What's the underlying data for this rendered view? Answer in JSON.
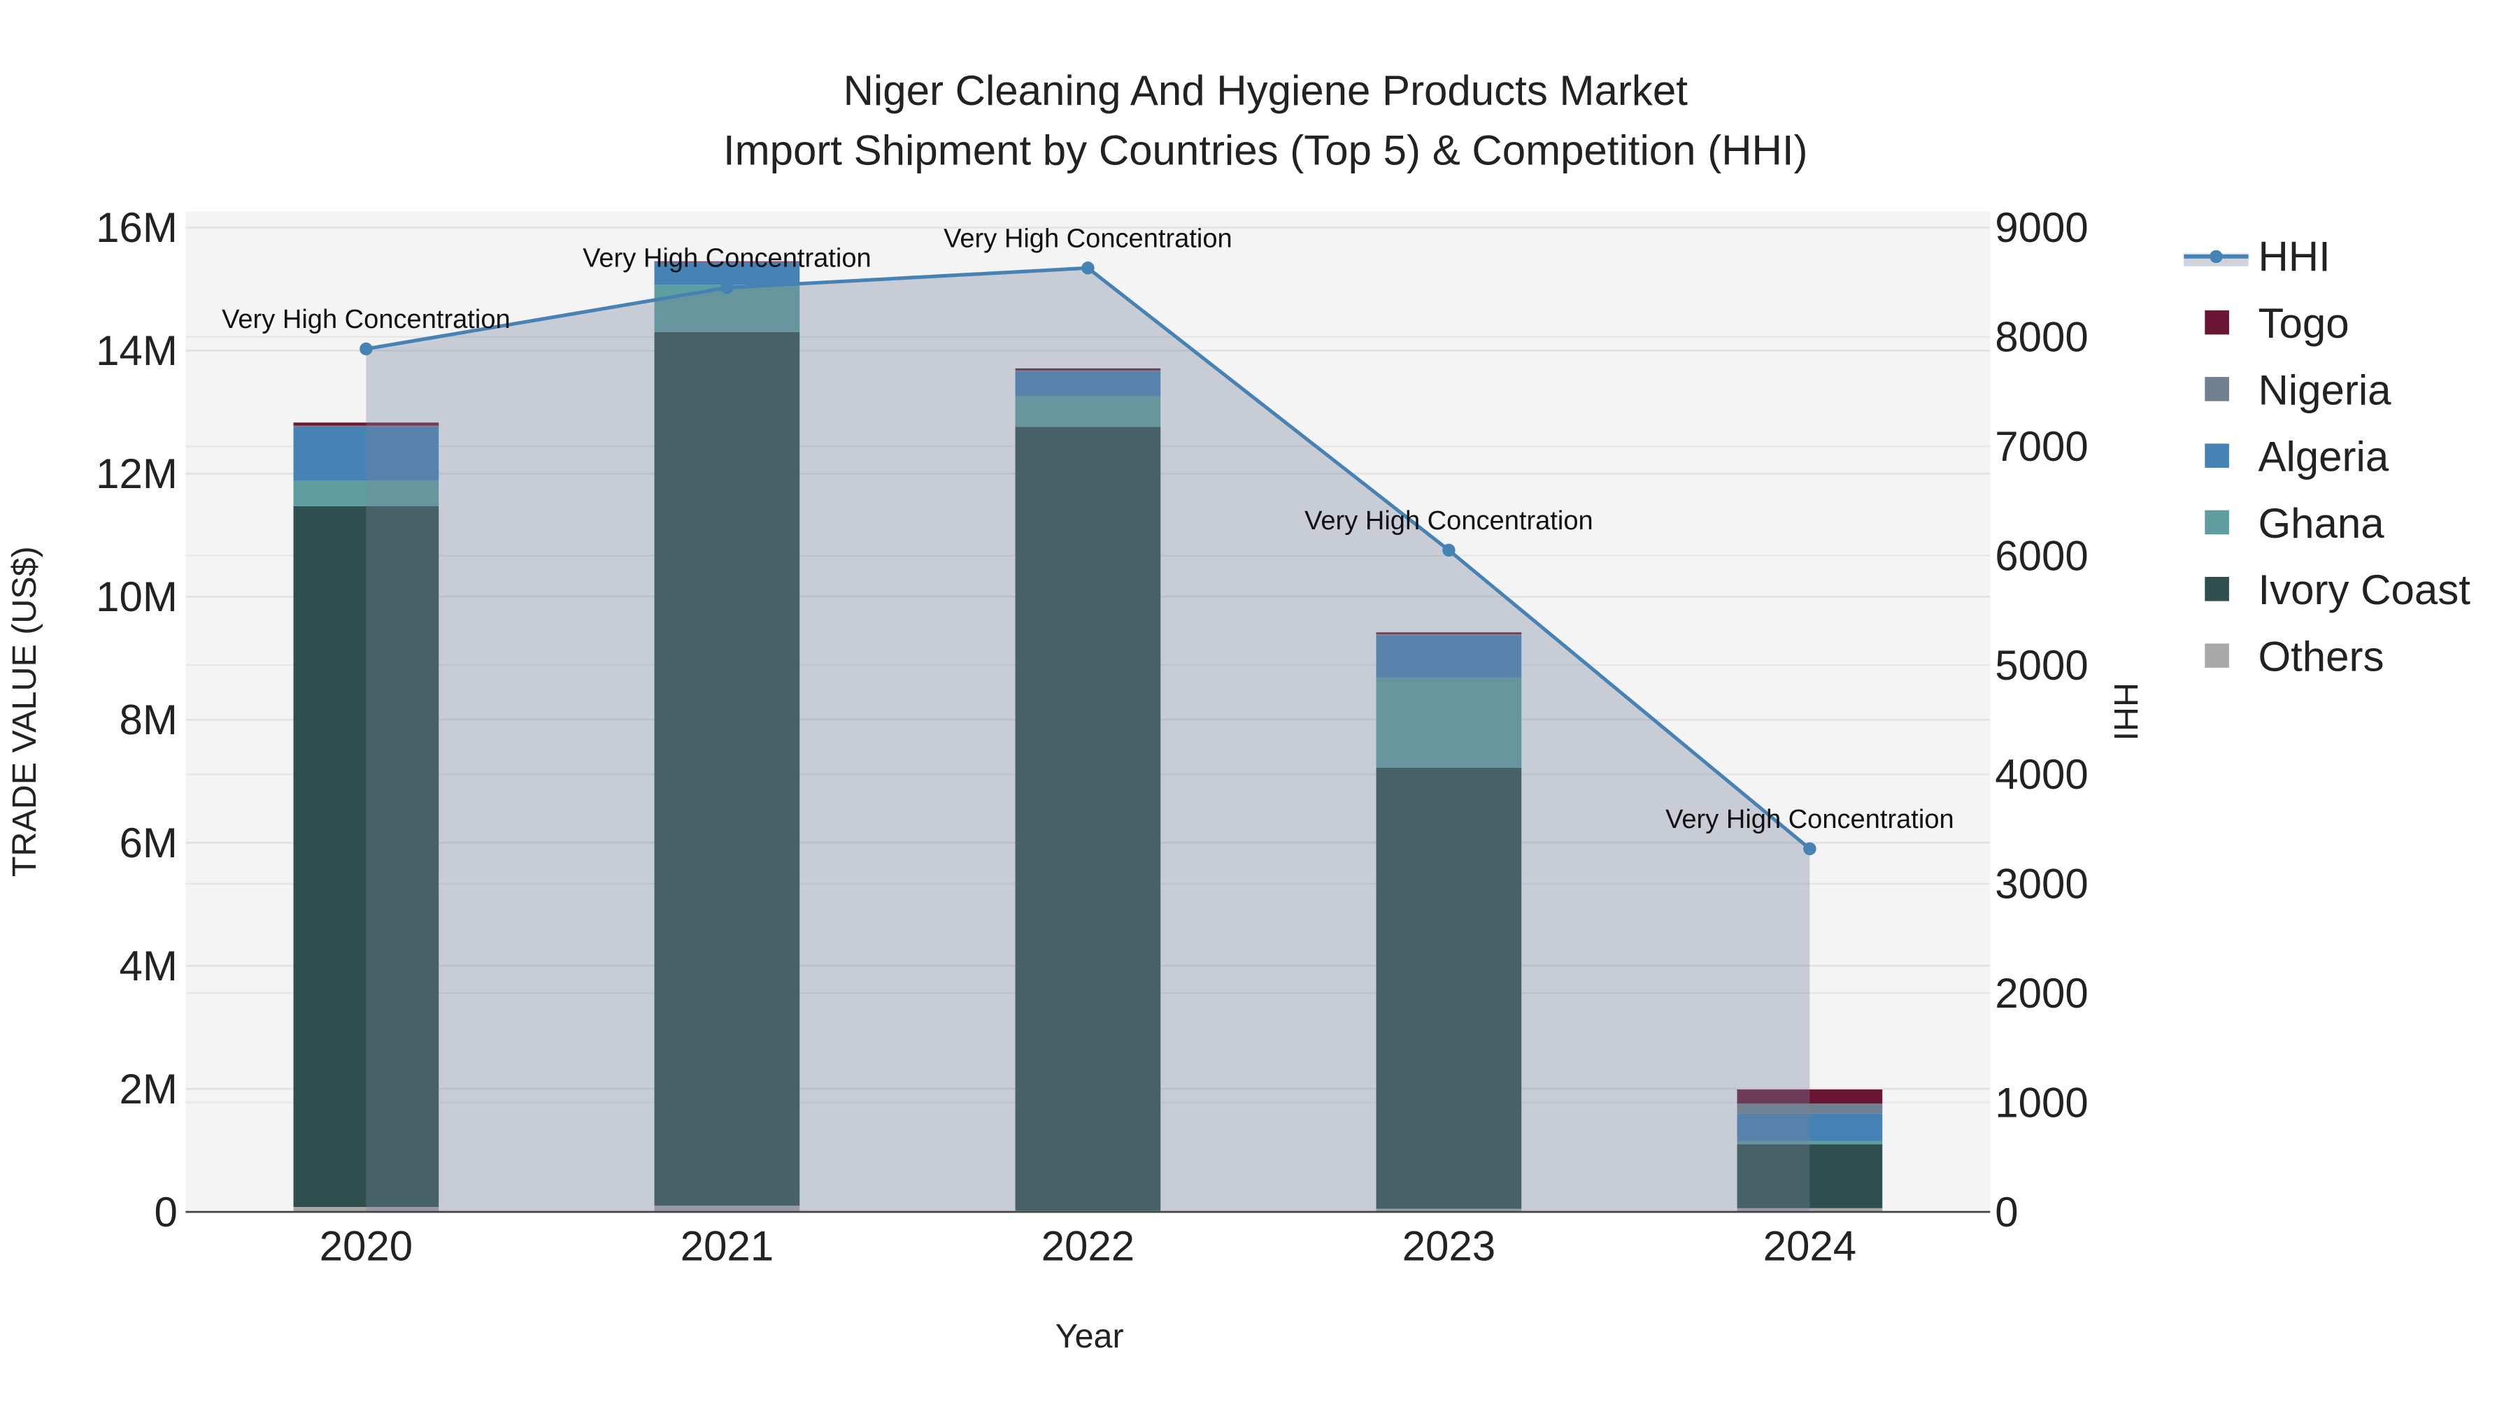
{
  "chart_data": {
    "type": "bar",
    "title": "Niger Cleaning And Hygiene Products Market",
    "subtitle": "Import Shipment by Countries (Top 5) & Competition (HHI)",
    "xlabel": "Year",
    "ylabel": "TRADE VALUE (US$)",
    "y2label": "HHI",
    "categories": [
      "2020",
      "2021",
      "2022",
      "2023",
      "2024"
    ],
    "ylim": [
      0,
      16000000
    ],
    "y2lim": [
      0,
      9000
    ],
    "yticks": [
      {
        "v": 0,
        "label": "0"
      },
      {
        "v": 2000000,
        "label": "2M"
      },
      {
        "v": 4000000,
        "label": "4M"
      },
      {
        "v": 6000000,
        "label": "6M"
      },
      {
        "v": 8000000,
        "label": "8M"
      },
      {
        "v": 10000000,
        "label": "10M"
      },
      {
        "v": 12000000,
        "label": "12M"
      },
      {
        "v": 14000000,
        "label": "14M"
      },
      {
        "v": 16000000,
        "label": "16M"
      }
    ],
    "y2ticks": [
      {
        "v": 0,
        "label": "0"
      },
      {
        "v": 1000,
        "label": "1000"
      },
      {
        "v": 2000,
        "label": "2000"
      },
      {
        "v": 3000,
        "label": "3000"
      },
      {
        "v": 4000,
        "label": "4000"
      },
      {
        "v": 5000,
        "label": "5000"
      },
      {
        "v": 6000,
        "label": "6000"
      },
      {
        "v": 7000,
        "label": "7000"
      },
      {
        "v": 8000,
        "label": "8000"
      },
      {
        "v": 9000,
        "label": "9000"
      }
    ],
    "stack_order": [
      "Others",
      "Ivory Coast",
      "Ghana",
      "Algeria",
      "Nigeria",
      "Togo"
    ],
    "series": [
      {
        "name": "Togo",
        "color": "#6b1535",
        "values": [
          50000,
          10000,
          30000,
          30000,
          230000
        ]
      },
      {
        "name": "Nigeria",
        "color": "#708090",
        "values": [
          20000,
          10000,
          20000,
          20000,
          160000
        ]
      },
      {
        "name": "Algeria",
        "color": "#4682b4",
        "values": [
          870000,
          360000,
          400000,
          680000,
          450000
        ]
      },
      {
        "name": "Ghana",
        "color": "#5f9ea0",
        "values": [
          420000,
          770000,
          500000,
          1470000,
          50000
        ]
      },
      {
        "name": "Ivory Coast",
        "color": "#2f4f4f",
        "values": [
          11390000,
          14200000,
          12740000,
          7170000,
          1040000
        ]
      },
      {
        "name": "Others",
        "color": "#a9a9a9",
        "values": [
          80000,
          100000,
          20000,
          50000,
          60000
        ]
      }
    ],
    "hhi": {
      "name": "HHI",
      "color": "#4682b4",
      "values": [
        7890,
        8450,
        8630,
        6050,
        3320
      ],
      "annotations": [
        "Very High Concentration",
        "Very High Concentration",
        "Very High Concentration",
        "Very High Concentration",
        "Very High Concentration"
      ]
    },
    "legend": {
      "placement": "right",
      "items": [
        "HHI",
        "Togo",
        "Nigeria",
        "Algeria",
        "Ghana",
        "Ivory Coast",
        "Others"
      ]
    },
    "grid": true
  }
}
